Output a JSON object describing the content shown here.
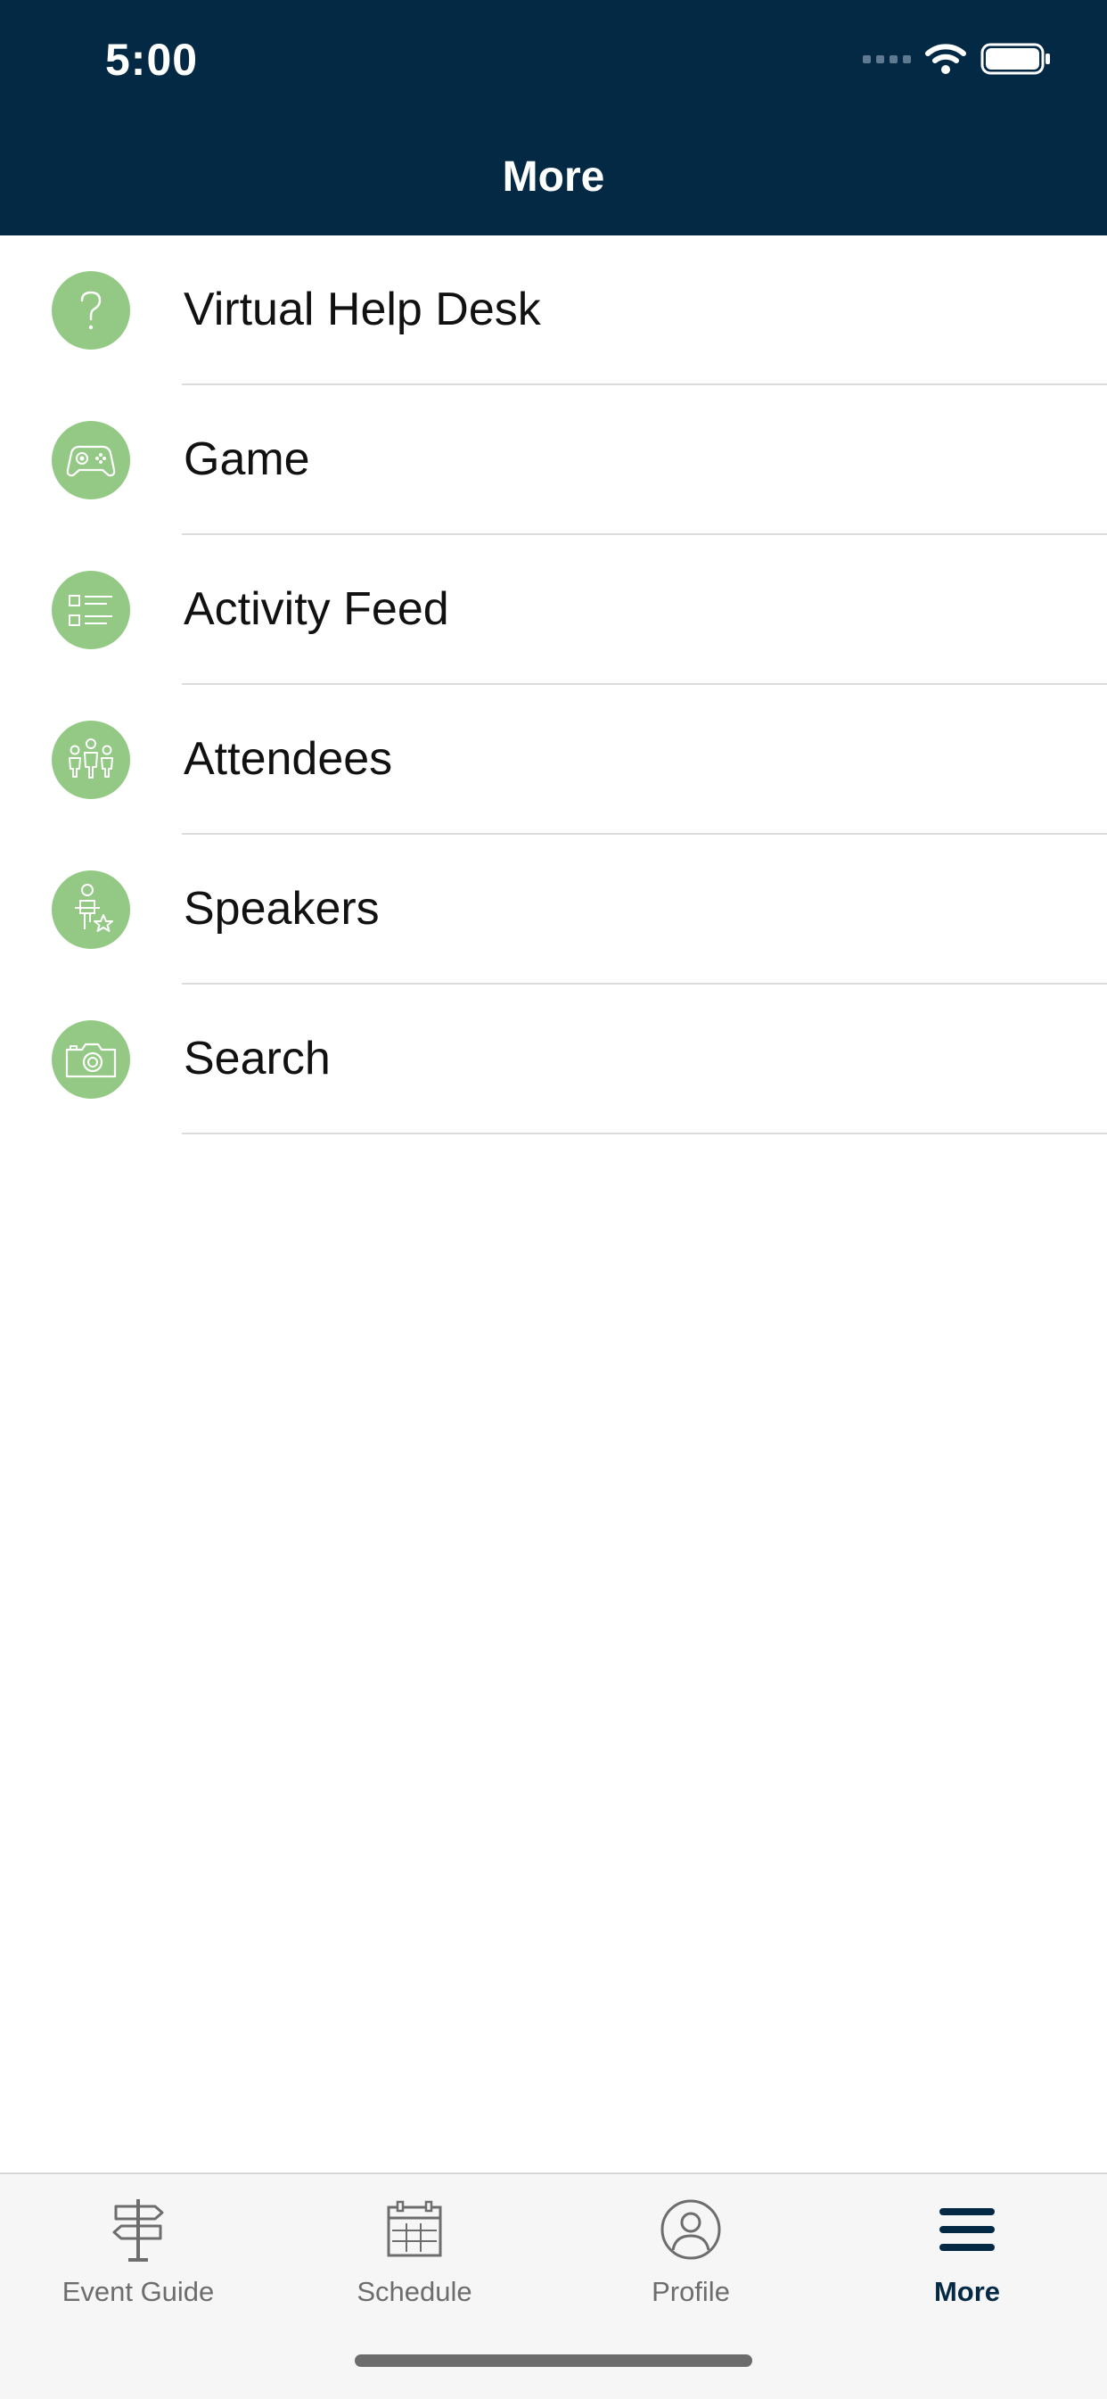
{
  "status_bar": {
    "time": "5:00"
  },
  "header": {
    "title": "More"
  },
  "menu": {
    "items": [
      {
        "label": "Virtual Help Desk",
        "icon": "question-icon"
      },
      {
        "label": "Game",
        "icon": "gamepad-icon"
      },
      {
        "label": "Activity Feed",
        "icon": "list-icon"
      },
      {
        "label": "Attendees",
        "icon": "people-icon"
      },
      {
        "label": "Speakers",
        "icon": "speaker-star-icon"
      },
      {
        "label": "Search",
        "icon": "camera-icon"
      }
    ]
  },
  "tab_bar": {
    "tabs": [
      {
        "label": "Event Guide",
        "icon": "signpost-icon",
        "active": false
      },
      {
        "label": "Schedule",
        "icon": "calendar-icon",
        "active": false
      },
      {
        "label": "Profile",
        "icon": "profile-icon",
        "active": false
      },
      {
        "label": "More",
        "icon": "hamburger-menu-icon",
        "active": true
      }
    ]
  },
  "colors": {
    "header_bg": "#042944",
    "icon_circle": "#93c985",
    "active_tab": "#042944",
    "inactive_tab": "#6d6d6d"
  }
}
